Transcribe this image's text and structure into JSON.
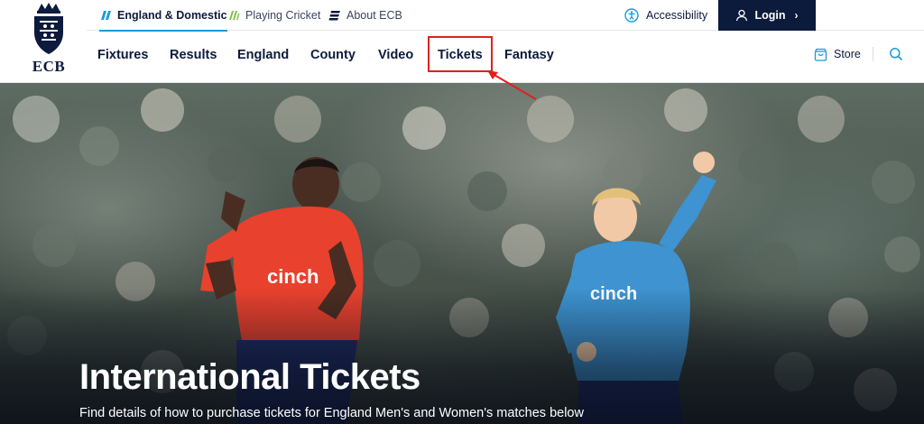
{
  "logo": {
    "text": "ECB"
  },
  "topbar": {
    "links": [
      {
        "label": "England & Domestic",
        "icon": "england-domestic-icon",
        "active": true
      },
      {
        "label": "Playing Cricket",
        "icon": "playing-cricket-icon",
        "active": false
      },
      {
        "label": "About ECB",
        "icon": "about-ecb-icon",
        "active": false
      }
    ],
    "accessibility_label": "Accessibility",
    "login_label": "Login"
  },
  "mainnav": {
    "items": [
      {
        "label": "Fixtures"
      },
      {
        "label": "Results"
      },
      {
        "label": "England"
      },
      {
        "label": "County"
      },
      {
        "label": "Video"
      },
      {
        "label": "Tickets"
      },
      {
        "label": "Fantasy"
      }
    ],
    "store_label": "Store"
  },
  "hero": {
    "title": "International Tickets",
    "subtitle": "Find details of how to purchase tickets for England Men's and Women's matches below",
    "shirt_logo": "cinch"
  },
  "colors": {
    "navy": "#0c1a3c",
    "accent": "#1a9bd6",
    "highlight": "#e02020",
    "england_red_kit": "#e8412e",
    "england_blue_kit": "#3e93d0"
  }
}
